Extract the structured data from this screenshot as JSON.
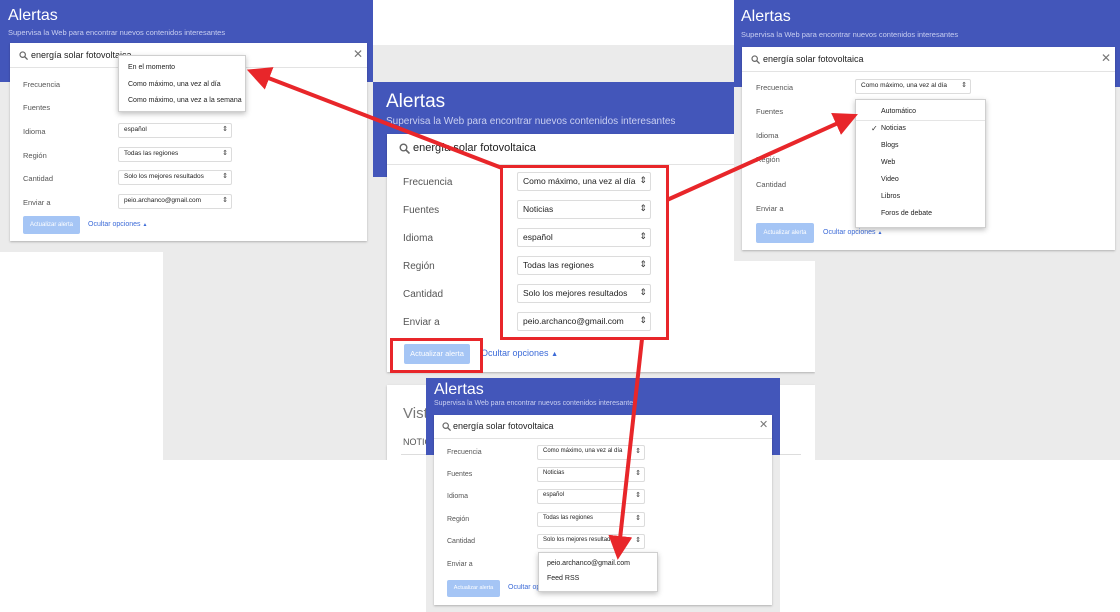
{
  "app": {
    "title": "Alertas",
    "subtitle": "Supervisa la Web para encontrar nuevos contenidos interesantes"
  },
  "search": {
    "query": "energía solar fotovoltaica"
  },
  "labels": {
    "frequency": "Frecuencia",
    "sources": "Fuentes",
    "language": "Idioma",
    "region": "Región",
    "quantity": "Cantidad",
    "send_to": "Enviar a"
  },
  "values": {
    "frequency": "Como máximo, una vez al día",
    "sources": "Noticias",
    "language": "español",
    "region": "Todas las regiones",
    "quantity": "Solo los mejores resultados",
    "quantity_truncated": "Solo los mejores resultado",
    "send_to": "peio.archanco@gmail.com"
  },
  "buttons": {
    "update": "Actualizar alerta",
    "hide_options": "Ocultar opciones"
  },
  "background_fragment": {
    "heading": "Vist",
    "subheading": "NOTIC"
  },
  "frequency_options": [
    "En el momento",
    "Como máximo, una vez al día",
    "Como máximo, una vez a la semana"
  ],
  "source_options": [
    "Automático",
    "Noticias",
    "Blogs",
    "Web",
    "Video",
    "Libros",
    "Foros de debate"
  ],
  "source_selected": "Noticias",
  "send_to_options": [
    "peio.archanco@gmail.com",
    "Feed RSS"
  ],
  "colors": {
    "header": "#4356ba",
    "annotation": "#e8262a",
    "button": "#a5c5f5",
    "link": "#3c6bd8"
  }
}
